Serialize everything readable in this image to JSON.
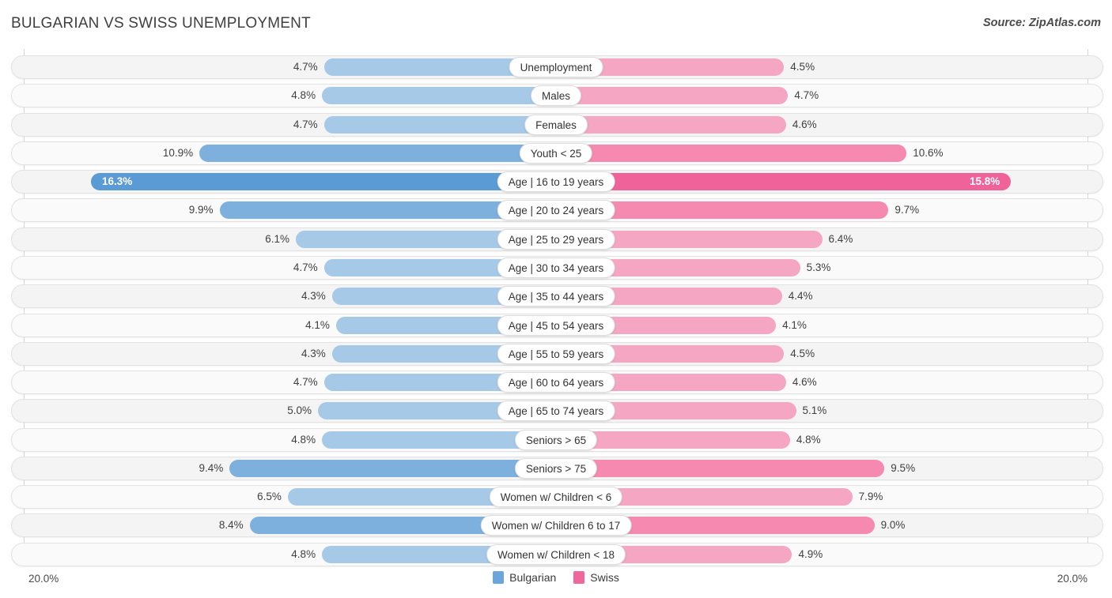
{
  "header": {
    "title": "BULGARIAN VS SWISS UNEMPLOYMENT",
    "source": "Source: ZipAtlas.com"
  },
  "axis": {
    "left_max": "20.0%",
    "right_max": "20.0%"
  },
  "legend": {
    "items": [
      {
        "label": "Bulgarian",
        "color": "#6aa6dd"
      },
      {
        "label": "Swiss",
        "color": "#f2679b"
      }
    ]
  },
  "colors": {
    "left_light": "#a6c9e8",
    "left_mid": "#7eb0de",
    "left_strong": "#5b9bd5",
    "right_light": "#f4a6c3",
    "right_mid": "#f589b0",
    "right_strong": "#f0639a",
    "track": "#f4f4f4",
    "track_alt": "#fafafa"
  },
  "chart_data": {
    "type": "bar",
    "subtype": "diverging-bidirectional",
    "title": "BULGARIAN VS SWISS UNEMPLOYMENT",
    "xlabel": "",
    "ylabel": "",
    "xlim": [
      20.0,
      20.0
    ],
    "axis_max_percent": 20.0,
    "unit": "%",
    "grid": true,
    "legend_position": "bottom-center",
    "categories": [
      "Unemployment",
      "Males",
      "Females",
      "Youth < 25",
      "Age | 16 to 19 years",
      "Age | 20 to 24 years",
      "Age | 25 to 29 years",
      "Age | 30 to 34 years",
      "Age | 35 to 44 years",
      "Age | 45 to 54 years",
      "Age | 55 to 59 years",
      "Age | 60 to 64 years",
      "Age | 65 to 74 years",
      "Seniors > 65",
      "Seniors > 75",
      "Women w/ Children < 6",
      "Women w/ Children 6 to 17",
      "Women w/ Children < 18"
    ],
    "series": [
      {
        "name": "Bulgarian",
        "side": "left",
        "color": "#6aa6dd",
        "values": [
          4.7,
          4.8,
          4.7,
          10.9,
          16.3,
          9.9,
          6.1,
          4.7,
          4.3,
          4.1,
          4.3,
          4.7,
          5.0,
          4.8,
          9.4,
          6.5,
          8.4,
          4.8
        ],
        "labels": [
          "4.7%",
          "4.8%",
          "4.7%",
          "10.9%",
          "16.3%",
          "9.9%",
          "6.1%",
          "4.7%",
          "4.3%",
          "4.1%",
          "4.3%",
          "4.7%",
          "5.0%",
          "4.8%",
          "9.4%",
          "6.5%",
          "8.4%",
          "4.8%"
        ]
      },
      {
        "name": "Swiss",
        "side": "right",
        "color": "#f2679b",
        "values": [
          4.5,
          4.7,
          4.6,
          10.6,
          15.8,
          9.7,
          6.4,
          5.3,
          4.4,
          4.1,
          4.5,
          4.6,
          5.1,
          4.8,
          9.5,
          7.9,
          9.0,
          4.9
        ],
        "labels": [
          "4.5%",
          "4.7%",
          "4.6%",
          "10.6%",
          "15.8%",
          "9.7%",
          "6.4%",
          "5.3%",
          "4.4%",
          "4.1%",
          "4.5%",
          "4.6%",
          "5.1%",
          "4.8%",
          "9.5%",
          "7.9%",
          "9.0%",
          "4.9%"
        ]
      }
    ]
  }
}
